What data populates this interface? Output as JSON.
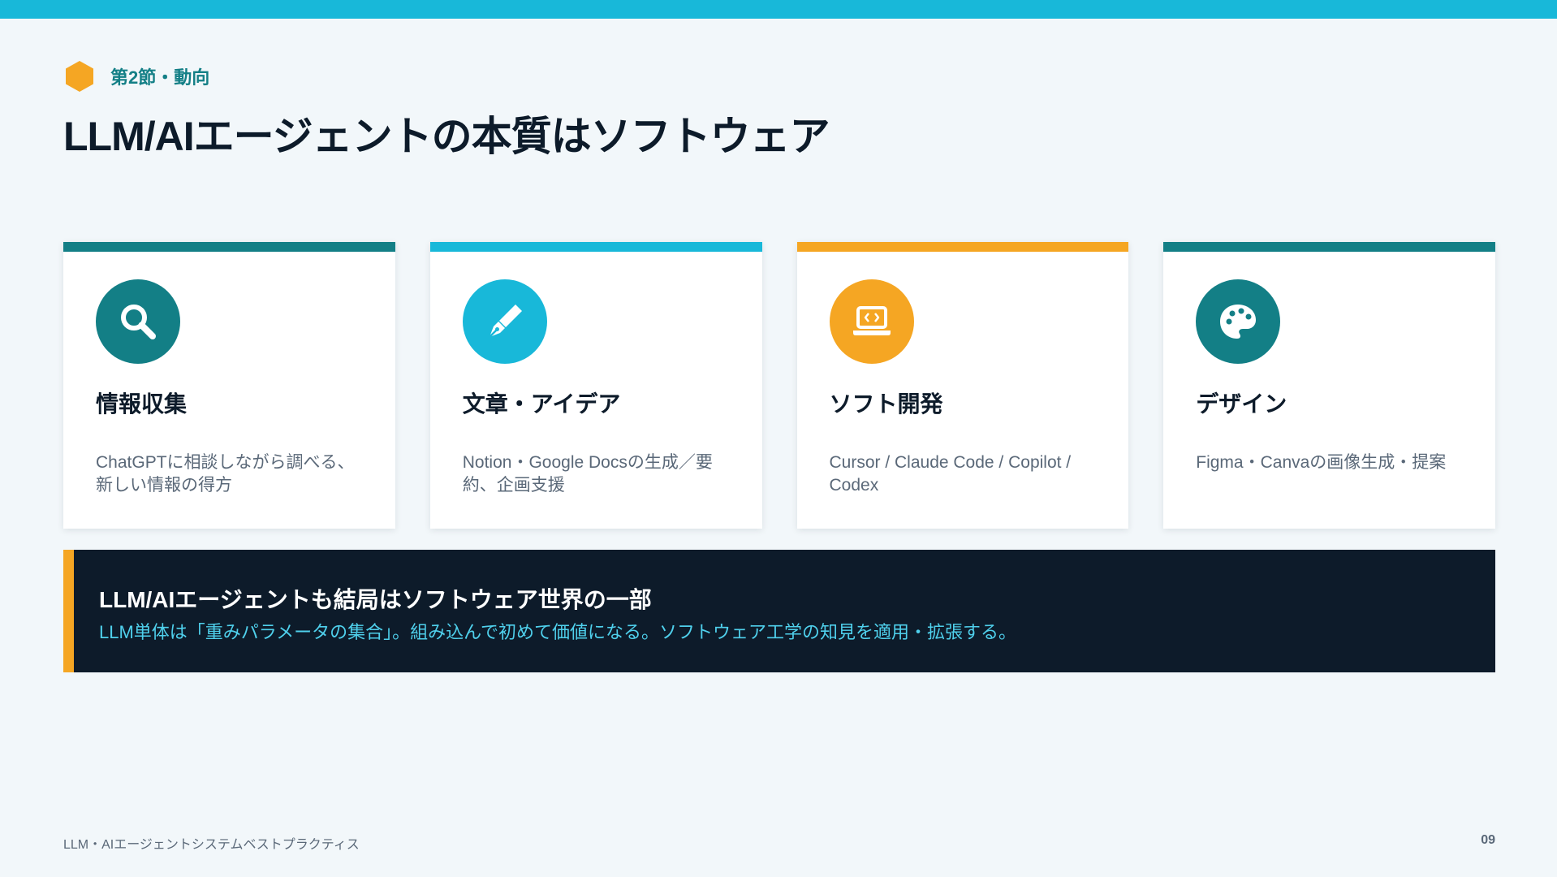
{
  "section": {
    "label": "第2節・動向",
    "icon": "hexagon-icon",
    "icon_color": "#f5a623"
  },
  "title": "LLM/AIエージェントの本質はソフトウェア",
  "colors": {
    "teal": "#137f86",
    "cyan": "#18b8d9",
    "orange": "#f5a623",
    "navy": "#0d1b2a",
    "background": "#f2f7fa"
  },
  "cards": [
    {
      "title": "情報収集",
      "desc": "ChatGPTに相談しながら調べる、新しい情報の得方",
      "icon": "search-icon",
      "accent": "#137f86"
    },
    {
      "title": "文章・アイデア",
      "desc": "Notion・Google Docsの生成／要約、企画支援",
      "icon": "pen-nib-icon",
      "accent": "#18b8d9"
    },
    {
      "title": "ソフト開発",
      "desc": "Cursor / Claude Code / Copilot / Codex",
      "icon": "laptop-code-icon",
      "accent": "#f5a623"
    },
    {
      "title": "デザイン",
      "desc": "Figma・Canvaの画像生成・提案",
      "icon": "palette-icon",
      "accent": "#137f86"
    }
  ],
  "banner": {
    "title": "LLM/AIエージェントも結局はソフトウェア世界の一部",
    "subtitle": "LLM単体は「重みパラメータの集合」。組み込んで初めて価値になる。ソフトウェア工学の知見を適用・拡張する。"
  },
  "footer": {
    "left": "LLM・AIエージェントシステムベストプラクティス",
    "page_number": "09"
  }
}
